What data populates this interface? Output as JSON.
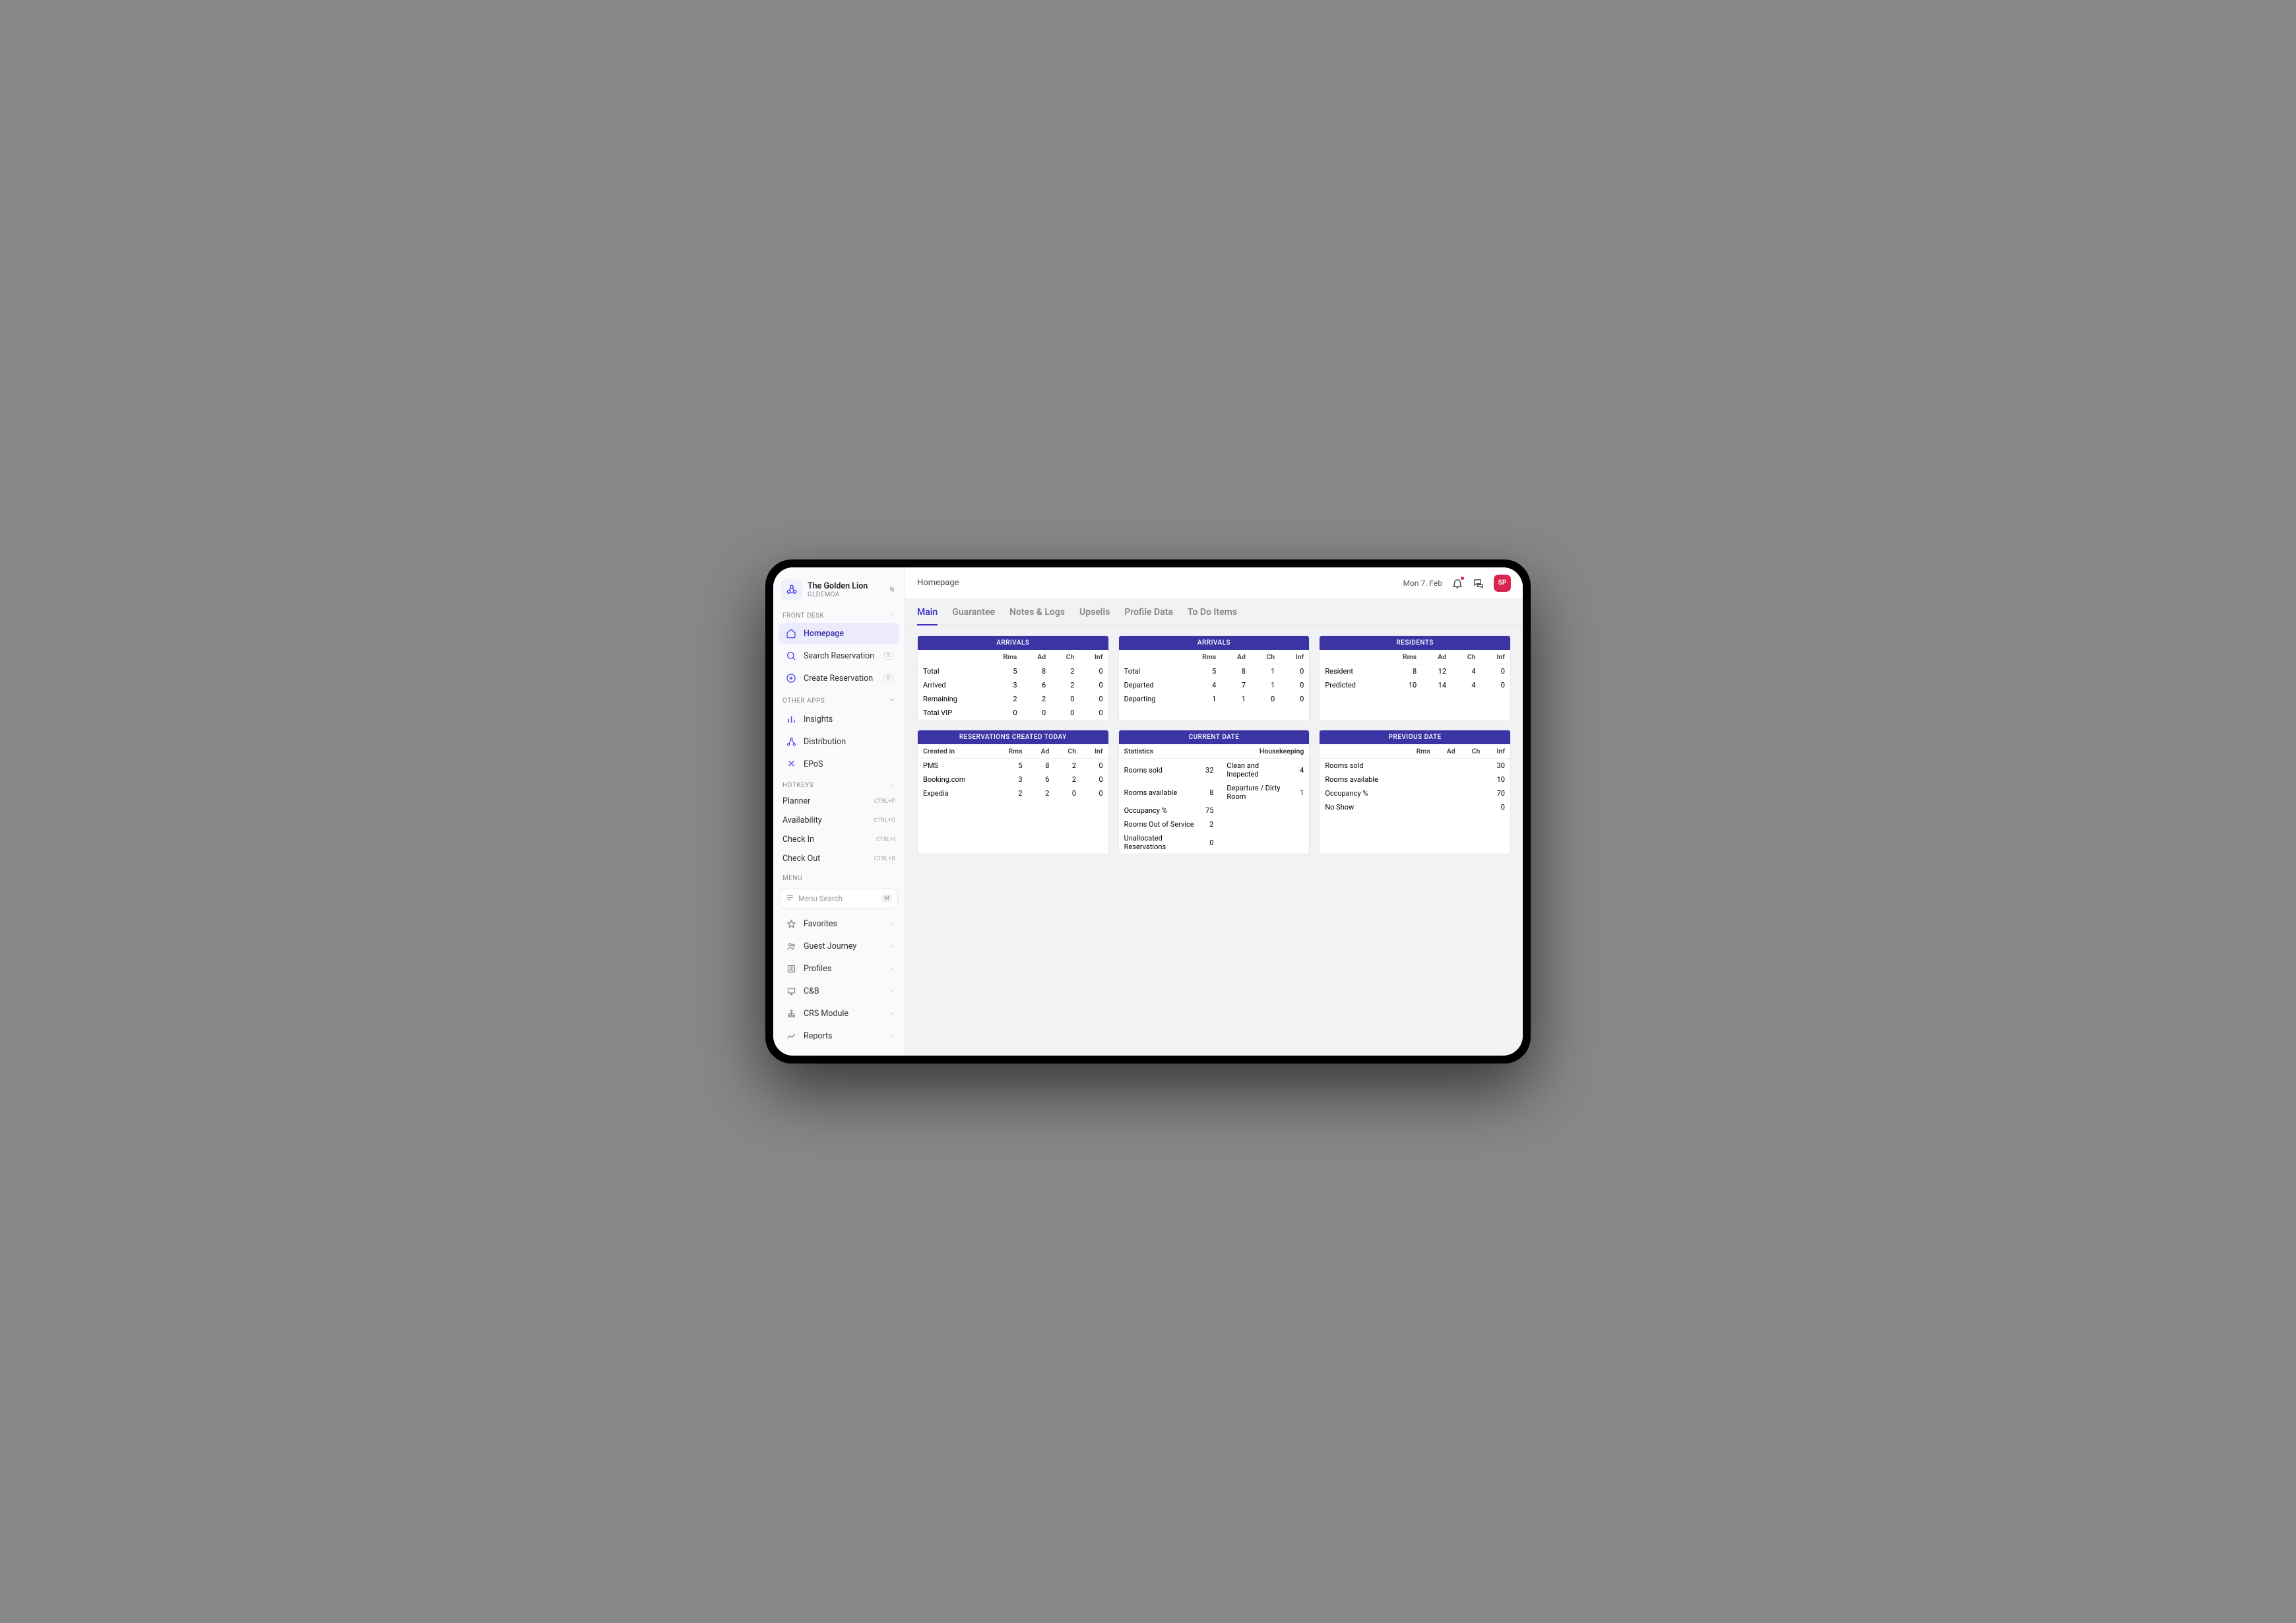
{
  "sidebar": {
    "hotel_name": "The Golden Lion",
    "hotel_code": "GLDEMOA",
    "sections": {
      "front_desk": {
        "title": "FRONT DESK",
        "items": [
          {
            "label": "Homepage",
            "kbd": ""
          },
          {
            "label": "Search Reservation",
            "kbd": "S"
          },
          {
            "label": "Create Reservation",
            "kbd": "R"
          }
        ]
      },
      "other_apps": {
        "title": "OTHER APPS",
        "items": [
          {
            "label": "Insights"
          },
          {
            "label": "Distribution"
          },
          {
            "label": "EPoS"
          }
        ]
      },
      "hotkeys": {
        "title": "HOTKEYS",
        "items": [
          {
            "label": "Planner",
            "shortcut": "CTRL+P"
          },
          {
            "label": "Availability",
            "shortcut": "CTRL+O"
          },
          {
            "label": "Check In",
            "shortcut": "CTRL+I"
          },
          {
            "label": "Check Out",
            "shortcut": "CTRL+B"
          }
        ]
      },
      "menu": {
        "title": "MENU",
        "search_placeholder": "Menu Search",
        "search_kbd": "M",
        "items": [
          {
            "label": "Favorites"
          },
          {
            "label": "Guest Journey"
          },
          {
            "label": "Profiles"
          },
          {
            "label": "C&B"
          },
          {
            "label": "CRS Module"
          },
          {
            "label": "Reports"
          }
        ]
      }
    }
  },
  "topbar": {
    "title": "Homepage",
    "date": "Mon 7. Feb",
    "avatar": "SP"
  },
  "tabs": [
    "Main",
    "Guarantee",
    "Notes & Logs",
    "Upsells",
    "Profile Data",
    "To Do Items"
  ],
  "cards": {
    "arrivals1": {
      "title": "ARRIVALS",
      "cols": [
        "",
        "Rms",
        "Ad",
        "Ch",
        "Inf"
      ],
      "rows": [
        [
          "Total",
          "5",
          "8",
          "2",
          "0"
        ],
        [
          "Arrived",
          "3",
          "6",
          "2",
          "0"
        ],
        [
          "Remaining",
          "2",
          "2",
          "0",
          "0"
        ],
        [
          "Total VIP",
          "0",
          "0",
          "0",
          "0"
        ]
      ]
    },
    "arrivals2": {
      "title": "ARRIVALS",
      "cols": [
        "",
        "Rms",
        "Ad",
        "Ch",
        "Inf"
      ],
      "rows": [
        [
          "Total",
          "5",
          "8",
          "1",
          "0"
        ],
        [
          "Departed",
          "4",
          "7",
          "1",
          "0"
        ],
        [
          "Departing",
          "1",
          "1",
          "0",
          "0"
        ]
      ]
    },
    "residents": {
      "title": "RESIDENTS",
      "cols": [
        "",
        "Rms",
        "Ad",
        "Ch",
        "Inf"
      ],
      "rows": [
        [
          "Resident",
          "8",
          "12",
          "4",
          "0"
        ],
        [
          "Predicted",
          "10",
          "14",
          "4",
          "0"
        ]
      ]
    },
    "reservations": {
      "title": "RESERVATIONS CREATED TODAY",
      "cols": [
        "Created in",
        "Rms",
        "Ad",
        "Ch",
        "Inf"
      ],
      "rows": [
        [
          "PMS",
          "5",
          "8",
          "2",
          "0"
        ],
        [
          "Booking.com",
          "3",
          "6",
          "2",
          "0"
        ],
        [
          "Expedia",
          "2",
          "2",
          "0",
          "0"
        ]
      ]
    },
    "current_date": {
      "title": "CURRENT DATE",
      "left_header": "Statistics",
      "right_header": "Housekeeping",
      "left_rows": [
        [
          "Rooms sold",
          "32"
        ],
        [
          "Rooms available",
          "8"
        ],
        [
          "Occupancy %",
          "75"
        ],
        [
          "Rooms Out of Service",
          "2"
        ],
        [
          "Unallocated Reservations",
          "0"
        ]
      ],
      "right_rows": [
        [
          "Clean and Inspected",
          "4"
        ],
        [
          "Departure / Dirty Room",
          "1"
        ]
      ]
    },
    "previous_date": {
      "title": "PREVIOUS DATE",
      "cols": [
        "",
        "Rms",
        "Ad",
        "Ch",
        "Inf"
      ],
      "rows": [
        [
          "Rooms sold",
          "",
          "",
          "",
          "30"
        ],
        [
          "Rooms available",
          "",
          "",
          "",
          "10"
        ],
        [
          "Occupancy %",
          "",
          "",
          "",
          "70"
        ],
        [
          "No Show",
          "",
          "",
          "",
          "0"
        ]
      ]
    }
  }
}
